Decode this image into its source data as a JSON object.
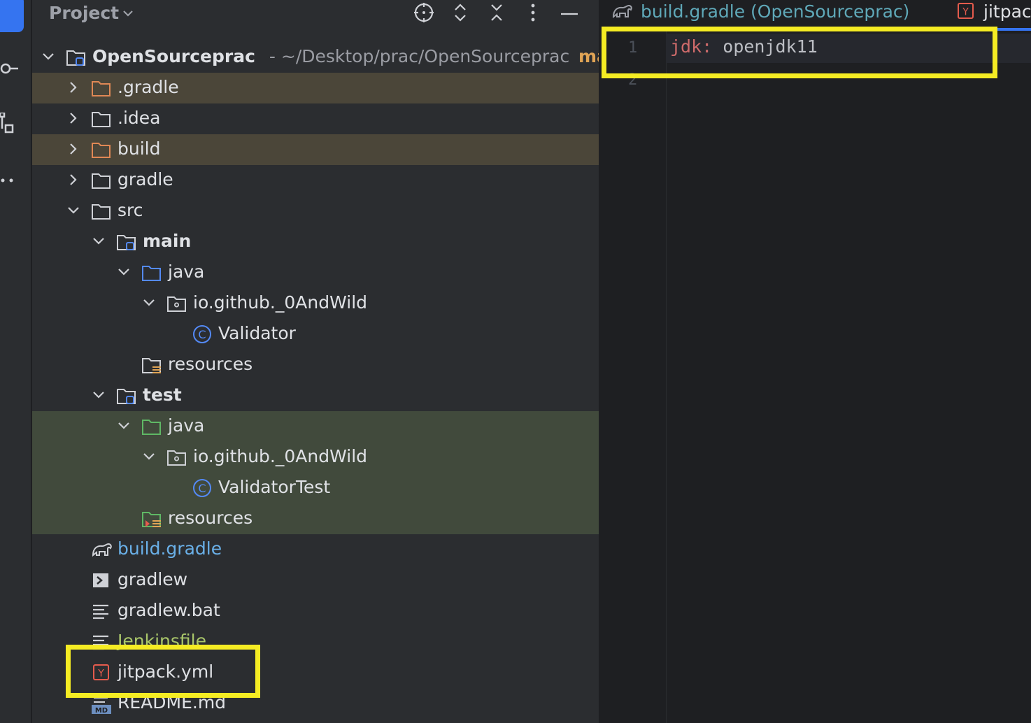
{
  "panel": {
    "title": "Project"
  },
  "tree": {
    "root": {
      "name": "OpenSourceprac",
      "path": "- ~/Desktop/prac/OpenSourceprac",
      "branch": "main"
    },
    "items": [
      {
        "label": ".gradle"
      },
      {
        "label": ".idea"
      },
      {
        "label": "build"
      },
      {
        "label": "gradle"
      },
      {
        "label": "src"
      },
      {
        "label": "main"
      },
      {
        "label": "java"
      },
      {
        "label": "io.github._0AndWild"
      },
      {
        "label": "Validator"
      },
      {
        "label": "resources"
      },
      {
        "label": "test"
      },
      {
        "label": "java"
      },
      {
        "label": "io.github._0AndWild"
      },
      {
        "label": "ValidatorTest"
      },
      {
        "label": "resources"
      },
      {
        "label": "build.gradle"
      },
      {
        "label": "gradlew"
      },
      {
        "label": "gradlew.bat"
      },
      {
        "label": "Jenkinsfile"
      },
      {
        "label": "jitpack.yml"
      },
      {
        "label": "README.md"
      }
    ]
  },
  "editor": {
    "tabs": [
      {
        "label": "build.gradle (OpenSourceprac)"
      },
      {
        "label": "jitpac"
      }
    ],
    "line_numbers": [
      "1",
      "2"
    ],
    "code": {
      "key": "jdk:",
      "value": "openjdk11"
    }
  },
  "colors": {
    "highlight": "#f5ec23",
    "excluded_bg": "#4b4639",
    "test_bg": "#414a3c",
    "accent": "#3574f0"
  }
}
